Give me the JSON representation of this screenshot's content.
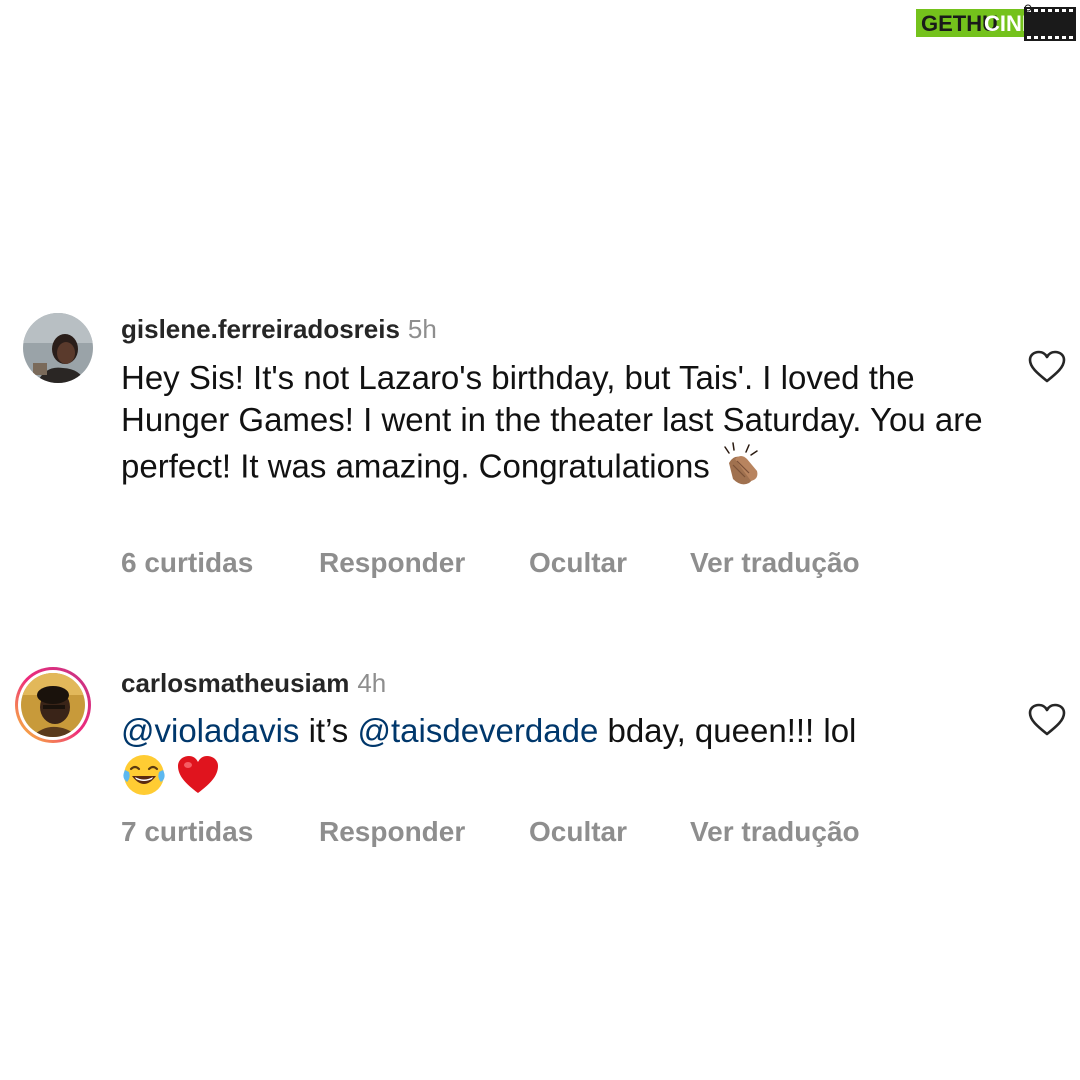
{
  "watermark": {
    "text_left": "GETHU",
    "text_right": "CINEMA",
    "bg_color": "#74c21c"
  },
  "comments": [
    {
      "username": "gislene.ferreiradosreis",
      "time": "5h",
      "text": "Hey Sis! It's not Lazaro's birthday, but Tais'. I loved the Hunger Games! I went in the theater last Saturday. You are perfect! It was amazing. Congratulations",
      "emoji": "clapping-hands-icon",
      "likes": "6 curtidas",
      "reply": "Responder",
      "hide": "Ocultar",
      "translate": "Ver tradução"
    },
    {
      "username": "carlosmatheusiam",
      "time": "4h",
      "mention_1": "@violadavis",
      "text_mid": " it’s ",
      "mention_2": "@taisdeverdade",
      "text_end": " bday, queen!!! lol",
      "emojis": [
        "laughing-face-icon",
        "red-heart-icon"
      ],
      "likes": "7 curtidas",
      "reply": "Responder",
      "hide": "Ocultar",
      "translate": "Ver tradução"
    }
  ],
  "colors": {
    "text": "#111111",
    "muted": "#8e8e8e",
    "mention": "#00376b",
    "story_ring_start": "#f9ce34",
    "story_ring_end": "#ee2a7b"
  }
}
